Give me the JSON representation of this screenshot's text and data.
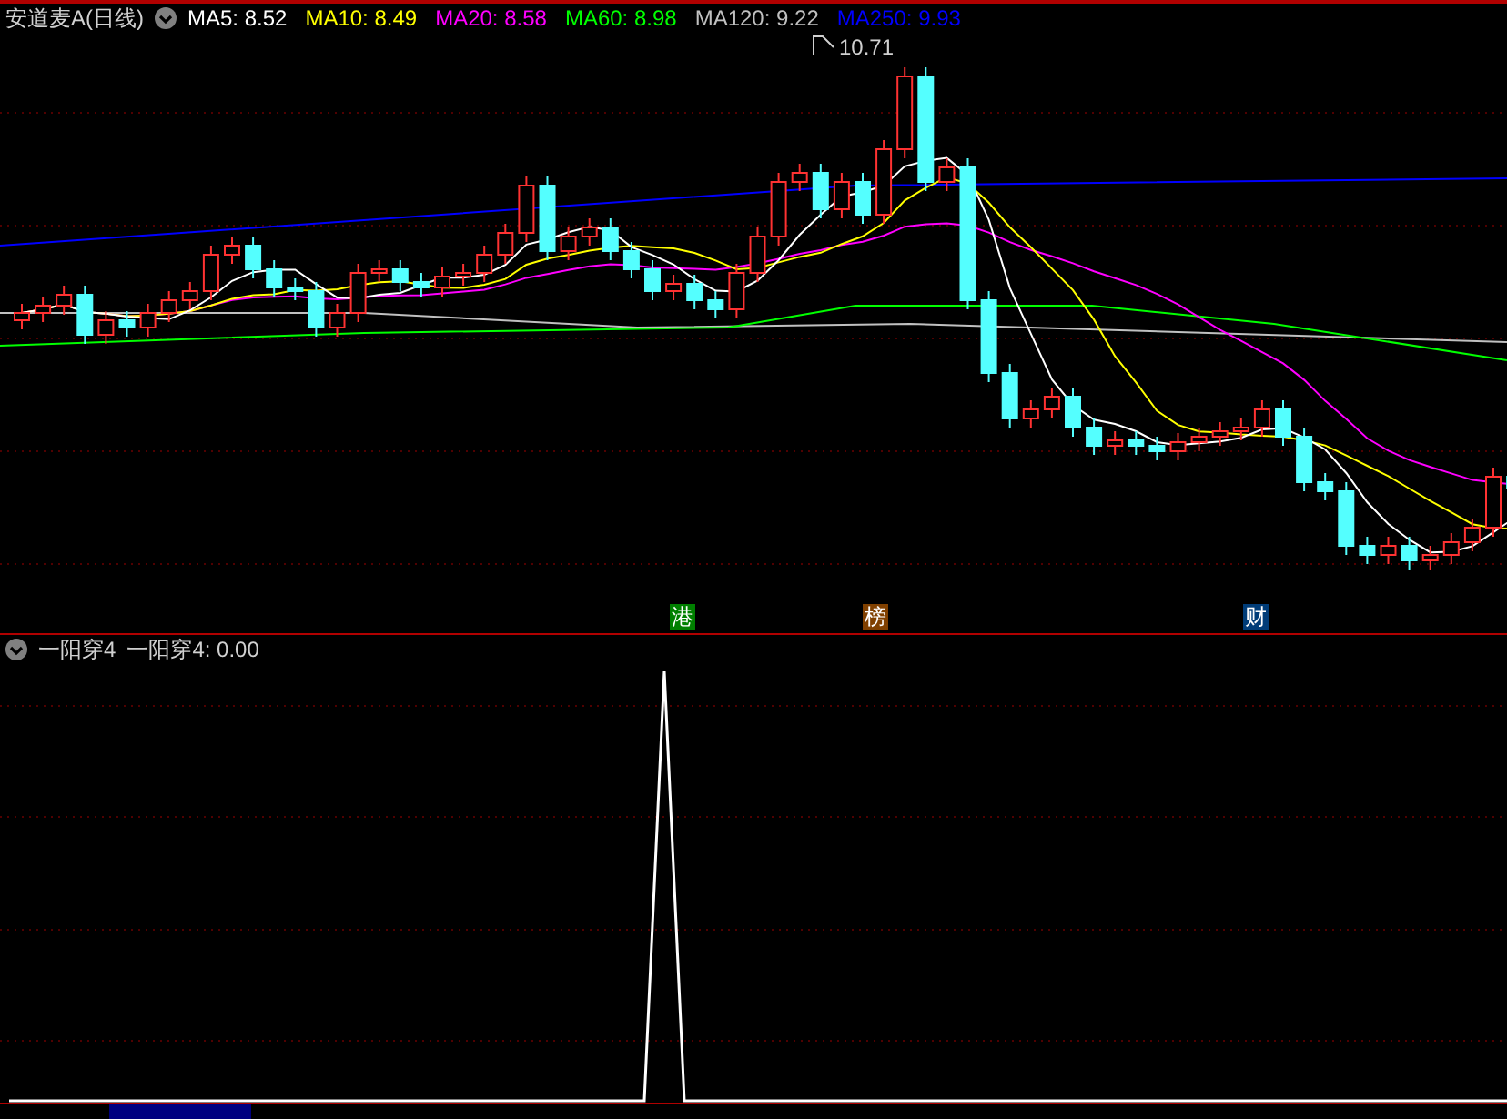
{
  "header": {
    "title": "安道麦A(日线)",
    "averages": [
      {
        "label": "MA5: 8.52",
        "color": "#ffffff"
      },
      {
        "label": "MA10: 8.49",
        "color": "#ffff00"
      },
      {
        "label": "MA20: 8.58",
        "color": "#ff00ff"
      },
      {
        "label": "MA60: 8.98",
        "color": "#00ff00"
      },
      {
        "label": "MA120: 9.22",
        "color": "#c0c0c0"
      },
      {
        "label": "MA250: 9.93",
        "color": "#0000ff"
      }
    ]
  },
  "peak_label": "10.71",
  "markers": [
    {
      "text": "港",
      "color": "#008000"
    },
    {
      "text": "榜",
      "color": "#804000"
    },
    {
      "text": "财",
      "color": "#003c78"
    }
  ],
  "indicator": {
    "name": "一阳穿4",
    "value": "一阳穿4: 0.00"
  }
}
